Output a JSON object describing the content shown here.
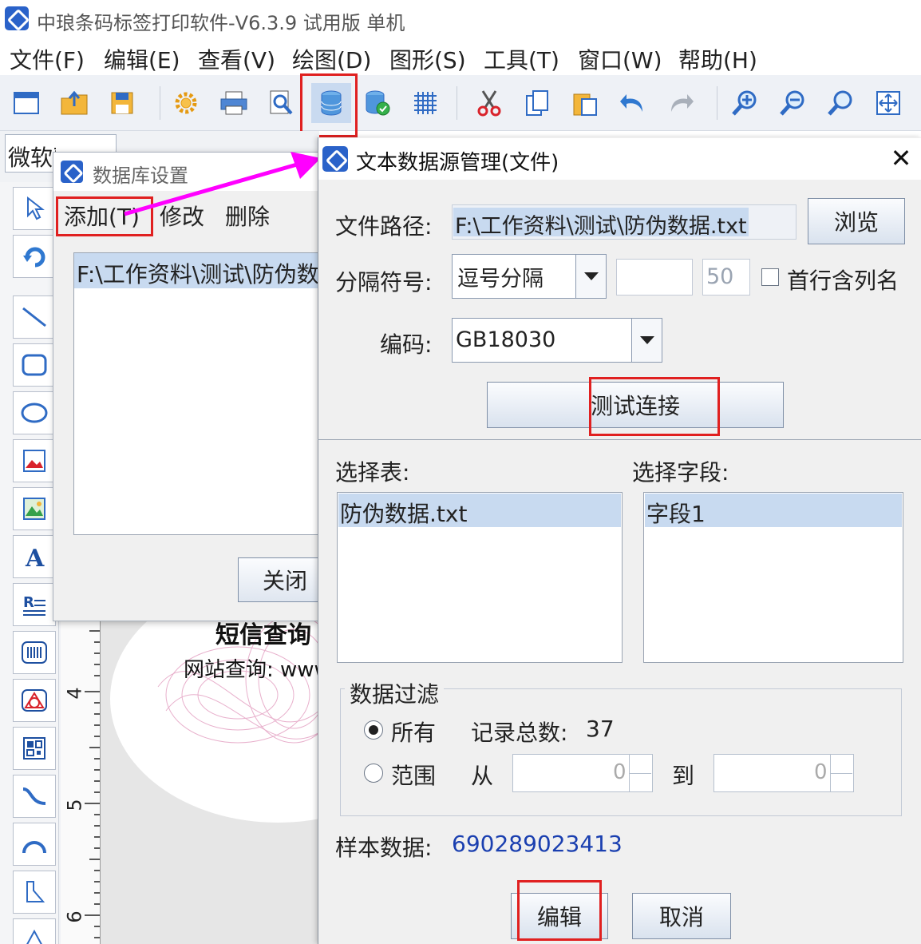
{
  "app": {
    "title": "中琅条码标签打印软件-V6.3.9 试用版 单机"
  },
  "menu": [
    "文件(F)",
    "编辑(E)",
    "查看(V)",
    "绘图(D)",
    "图形(S)",
    "工具(T)",
    "窗口(W)",
    "帮助(H)"
  ],
  "toolbar_icons": [
    "new-icon",
    "open-icon",
    "save-icon",
    "settings-icon",
    "print-icon",
    "print-preview-icon",
    "database-icon",
    "database-connect-icon",
    "grid-icon",
    "cut-icon",
    "copy-icon",
    "paste-icon",
    "undo-icon",
    "redo-icon",
    "zoom-in-icon",
    "zoom-out-icon",
    "zoom-icon",
    "fit-page-icon"
  ],
  "font_field": "微软雅黑",
  "left_tools": [
    "pointer-icon",
    "rotate-icon",
    "line-icon",
    "rectangle-icon",
    "ellipse-icon",
    "image-icon",
    "picture-icon",
    "text-icon",
    "rich-text-icon",
    "barcode-icon",
    "shape-icon",
    "qrcode-icon",
    "curve-icon",
    "arc-icon",
    "polygon-icon",
    "triangle-icon"
  ],
  "ruler": {
    "marks": [
      "4",
      "5",
      "6"
    ]
  },
  "canvas": {
    "text1": "短信查询",
    "text2": "网站查询: www"
  },
  "db_dialog": {
    "title": "数据库设置",
    "add": "添加(T)",
    "modify": "修改",
    "delete": "删除",
    "list_item": "F:\\工作资料\\测试\\防伪数据.txt",
    "close": "关闭"
  },
  "ds_dialog": {
    "title": "文本数据源管理(文件)",
    "close_glyph": "✕",
    "path_label": "文件路径:",
    "path_value": "F:\\工作资料\\测试\\防伪数据.txt",
    "browse": "浏览",
    "sep_label": "分隔符号:",
    "sep_value": "逗号分隔",
    "sep_custom": "",
    "sep_width": "50",
    "first_row_label": "首行含列名",
    "encoding_label": "编码:",
    "encoding_value": "GB18030",
    "test_btn": "测试连接",
    "table_label": "选择表:",
    "table_item": "防伪数据.txt",
    "field_label": "选择字段:",
    "field_item": "字段1",
    "filter_label": "数据过滤",
    "all_label": "所有",
    "total_label": "记录总数:",
    "total_value": "37",
    "range_label": "范围",
    "from_label": "从",
    "from_value": "0",
    "to_label": "到",
    "to_value": "0",
    "sample_label": "样本数据:",
    "sample_value": "690289023413",
    "edit_btn": "编辑",
    "cancel_btn": "取消"
  },
  "colors": {
    "accent": "#2a62c9",
    "highlight": "#e02020",
    "arrow": "#ff00ff",
    "sample": "#1a3fb0",
    "selection": "#c8daf0"
  }
}
